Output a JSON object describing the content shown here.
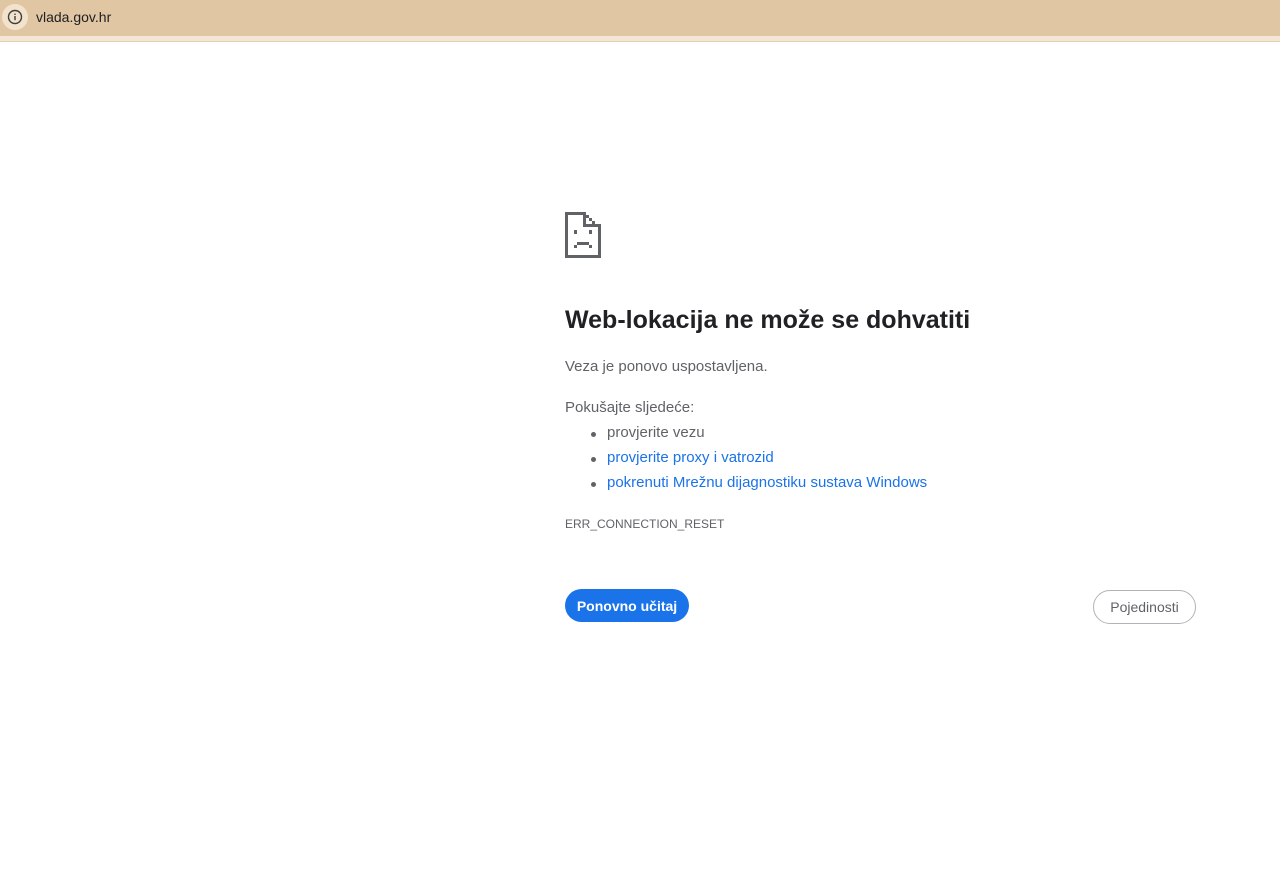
{
  "browser": {
    "url": "vlada.gov.hr",
    "site_info_icon": "info-icon"
  },
  "error_page": {
    "icon": "sad-page-icon",
    "title": "Web-lokacija ne može se dohvatiti",
    "message": "Veza je ponovo uspostavljena.",
    "try_heading": "Pokušajte sljedeće:",
    "suggestions": [
      {
        "text": "provjerite vezu",
        "is_link": false
      },
      {
        "text": "provjerite proxy i vatrozid",
        "is_link": true
      },
      {
        "text": "pokrenuti Mrežnu dijagnostiku sustava Windows",
        "is_link": true
      }
    ],
    "error_code": "ERR_CONNECTION_RESET",
    "reload_button": "Ponovno učitaj",
    "details_button": "Pojedinosti"
  },
  "colors": {
    "address_bar": "#e0c6a3",
    "primary_button": "#1a73e8",
    "link": "#1a73e8",
    "text": "#202124",
    "secondary_text": "#5f6368"
  }
}
